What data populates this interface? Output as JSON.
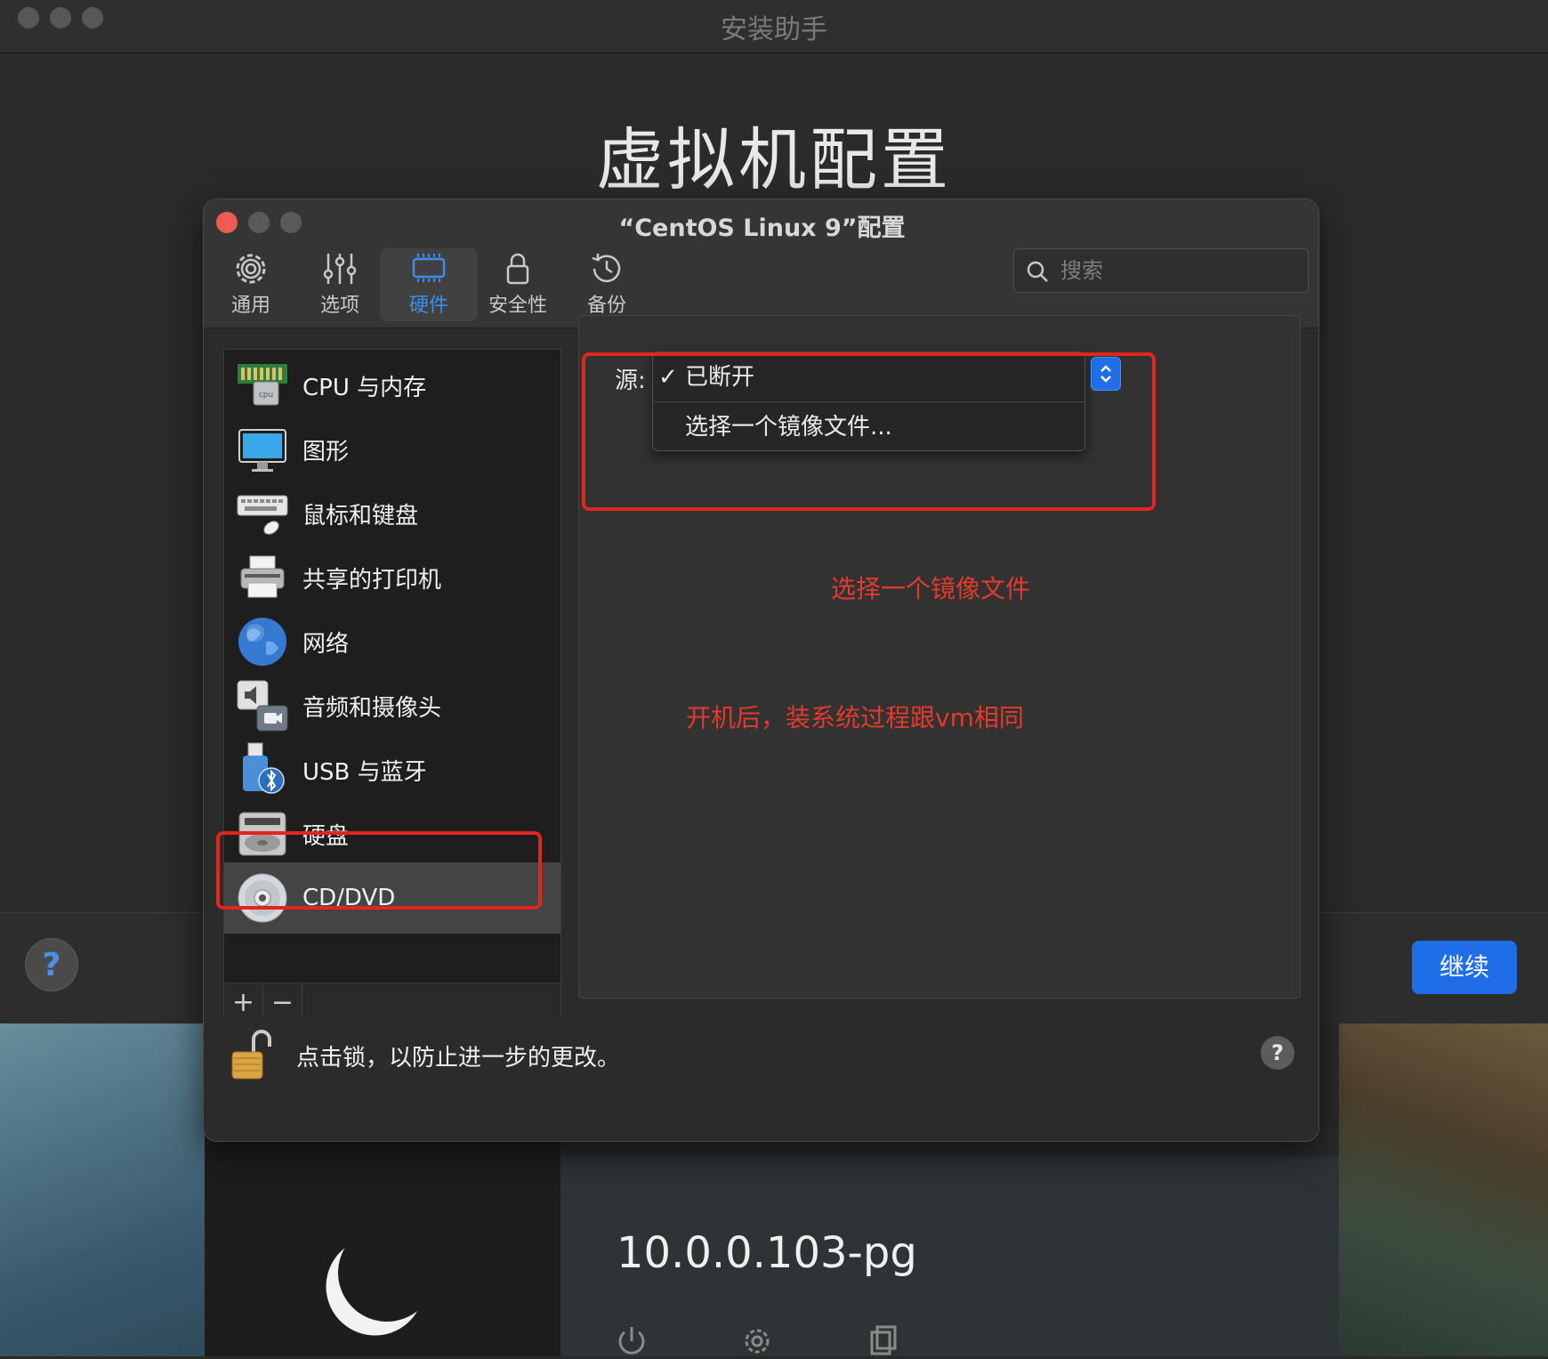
{
  "outer_window": {
    "title": "安装助手",
    "heading": "虚拟机配置",
    "help_label": "?",
    "continue_label": "继续"
  },
  "background": {
    "vm_name": "10.0.0.103-pg",
    "icons": [
      "power-icon",
      "gear-icon",
      "copy-icon"
    ]
  },
  "dialog": {
    "title": "“CentOS Linux 9”配置",
    "tabs": [
      {
        "label": "通用",
        "icon": "gear-icon"
      },
      {
        "label": "选项",
        "icon": "sliders-icon"
      },
      {
        "label": "硬件",
        "icon": "hardware-icon",
        "active": true
      },
      {
        "label": "安全性",
        "icon": "lock-icon"
      },
      {
        "label": "备份",
        "icon": "history-icon"
      }
    ],
    "search": {
      "placeholder": "搜索",
      "value": ""
    },
    "sidebar": {
      "items": [
        {
          "label": "CPU 与内存",
          "icon": "cpu-memory-icon"
        },
        {
          "label": "图形",
          "icon": "display-icon"
        },
        {
          "label": "鼠标和键盘",
          "icon": "keyboard-mouse-icon"
        },
        {
          "label": "共享的打印机",
          "icon": "printer-icon"
        },
        {
          "label": "网络",
          "icon": "globe-icon"
        },
        {
          "label": "音频和摄像头",
          "icon": "audio-camera-icon"
        },
        {
          "label": "USB 与蓝牙",
          "icon": "usb-bluetooth-icon"
        },
        {
          "label": "硬盘",
          "icon": "hard-disk-icon"
        },
        {
          "label": "CD/DVD",
          "icon": "cd-dvd-icon",
          "active": true
        }
      ],
      "add_label": "+",
      "remove_label": "−"
    },
    "source": {
      "label": "源:",
      "options": [
        {
          "label": "已断开",
          "checked": true,
          "check_mark": "✓"
        },
        {
          "label": "选择一个镜像文件...",
          "checked": false
        }
      ]
    },
    "annotations": {
      "choose_image": "选择一个镜像文件",
      "after_boot": "开机后，装系统过程跟vm相同"
    },
    "lock": {
      "text": "点击锁，以防止进一步的更改。"
    },
    "help_label": "?"
  },
  "colors": {
    "accent": "#1f6ee8",
    "annotation_red": "#e0261f",
    "close_button": "#ec5c55"
  }
}
